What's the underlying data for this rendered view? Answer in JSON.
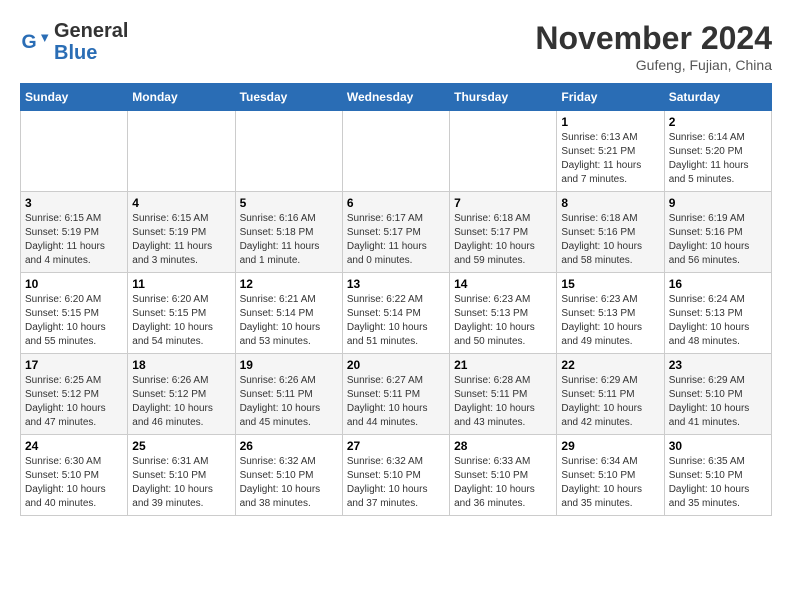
{
  "header": {
    "logo": {
      "general": "General",
      "blue": "Blue"
    },
    "title": "November 2024",
    "subtitle": "Gufeng, Fujian, China"
  },
  "calendar": {
    "days_of_week": [
      "Sunday",
      "Monday",
      "Tuesday",
      "Wednesday",
      "Thursday",
      "Friday",
      "Saturday"
    ],
    "weeks": [
      [
        {
          "day": "",
          "info": ""
        },
        {
          "day": "",
          "info": ""
        },
        {
          "day": "",
          "info": ""
        },
        {
          "day": "",
          "info": ""
        },
        {
          "day": "",
          "info": ""
        },
        {
          "day": "1",
          "info": "Sunrise: 6:13 AM\nSunset: 5:21 PM\nDaylight: 11 hours and 7 minutes."
        },
        {
          "day": "2",
          "info": "Sunrise: 6:14 AM\nSunset: 5:20 PM\nDaylight: 11 hours and 5 minutes."
        }
      ],
      [
        {
          "day": "3",
          "info": "Sunrise: 6:15 AM\nSunset: 5:19 PM\nDaylight: 11 hours and 4 minutes."
        },
        {
          "day": "4",
          "info": "Sunrise: 6:15 AM\nSunset: 5:19 PM\nDaylight: 11 hours and 3 minutes."
        },
        {
          "day": "5",
          "info": "Sunrise: 6:16 AM\nSunset: 5:18 PM\nDaylight: 11 hours and 1 minute."
        },
        {
          "day": "6",
          "info": "Sunrise: 6:17 AM\nSunset: 5:17 PM\nDaylight: 11 hours and 0 minutes."
        },
        {
          "day": "7",
          "info": "Sunrise: 6:18 AM\nSunset: 5:17 PM\nDaylight: 10 hours and 59 minutes."
        },
        {
          "day": "8",
          "info": "Sunrise: 6:18 AM\nSunset: 5:16 PM\nDaylight: 10 hours and 58 minutes."
        },
        {
          "day": "9",
          "info": "Sunrise: 6:19 AM\nSunset: 5:16 PM\nDaylight: 10 hours and 56 minutes."
        }
      ],
      [
        {
          "day": "10",
          "info": "Sunrise: 6:20 AM\nSunset: 5:15 PM\nDaylight: 10 hours and 55 minutes."
        },
        {
          "day": "11",
          "info": "Sunrise: 6:20 AM\nSunset: 5:15 PM\nDaylight: 10 hours and 54 minutes."
        },
        {
          "day": "12",
          "info": "Sunrise: 6:21 AM\nSunset: 5:14 PM\nDaylight: 10 hours and 53 minutes."
        },
        {
          "day": "13",
          "info": "Sunrise: 6:22 AM\nSunset: 5:14 PM\nDaylight: 10 hours and 51 minutes."
        },
        {
          "day": "14",
          "info": "Sunrise: 6:23 AM\nSunset: 5:13 PM\nDaylight: 10 hours and 50 minutes."
        },
        {
          "day": "15",
          "info": "Sunrise: 6:23 AM\nSunset: 5:13 PM\nDaylight: 10 hours and 49 minutes."
        },
        {
          "day": "16",
          "info": "Sunrise: 6:24 AM\nSunset: 5:13 PM\nDaylight: 10 hours and 48 minutes."
        }
      ],
      [
        {
          "day": "17",
          "info": "Sunrise: 6:25 AM\nSunset: 5:12 PM\nDaylight: 10 hours and 47 minutes."
        },
        {
          "day": "18",
          "info": "Sunrise: 6:26 AM\nSunset: 5:12 PM\nDaylight: 10 hours and 46 minutes."
        },
        {
          "day": "19",
          "info": "Sunrise: 6:26 AM\nSunset: 5:11 PM\nDaylight: 10 hours and 45 minutes."
        },
        {
          "day": "20",
          "info": "Sunrise: 6:27 AM\nSunset: 5:11 PM\nDaylight: 10 hours and 44 minutes."
        },
        {
          "day": "21",
          "info": "Sunrise: 6:28 AM\nSunset: 5:11 PM\nDaylight: 10 hours and 43 minutes."
        },
        {
          "day": "22",
          "info": "Sunrise: 6:29 AM\nSunset: 5:11 PM\nDaylight: 10 hours and 42 minutes."
        },
        {
          "day": "23",
          "info": "Sunrise: 6:29 AM\nSunset: 5:10 PM\nDaylight: 10 hours and 41 minutes."
        }
      ],
      [
        {
          "day": "24",
          "info": "Sunrise: 6:30 AM\nSunset: 5:10 PM\nDaylight: 10 hours and 40 minutes."
        },
        {
          "day": "25",
          "info": "Sunrise: 6:31 AM\nSunset: 5:10 PM\nDaylight: 10 hours and 39 minutes."
        },
        {
          "day": "26",
          "info": "Sunrise: 6:32 AM\nSunset: 5:10 PM\nDaylight: 10 hours and 38 minutes."
        },
        {
          "day": "27",
          "info": "Sunrise: 6:32 AM\nSunset: 5:10 PM\nDaylight: 10 hours and 37 minutes."
        },
        {
          "day": "28",
          "info": "Sunrise: 6:33 AM\nSunset: 5:10 PM\nDaylight: 10 hours and 36 minutes."
        },
        {
          "day": "29",
          "info": "Sunrise: 6:34 AM\nSunset: 5:10 PM\nDaylight: 10 hours and 35 minutes."
        },
        {
          "day": "30",
          "info": "Sunrise: 6:35 AM\nSunset: 5:10 PM\nDaylight: 10 hours and 35 minutes."
        }
      ]
    ]
  }
}
